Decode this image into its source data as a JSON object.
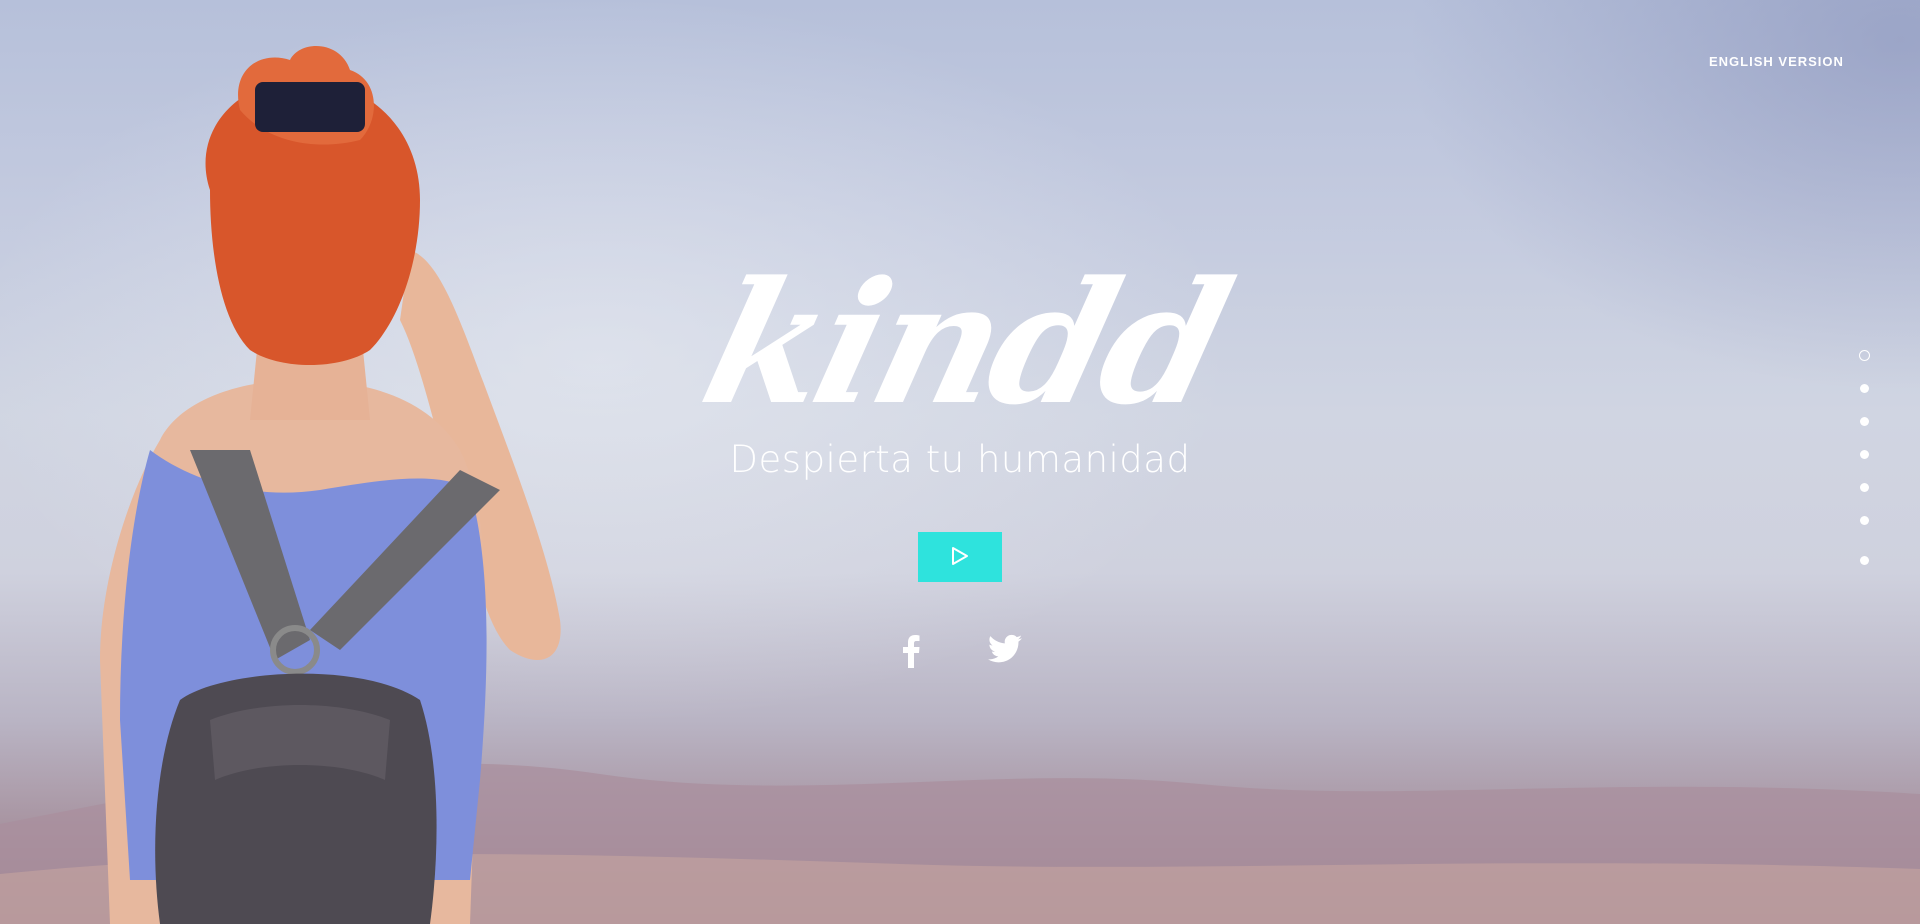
{
  "header": {
    "language_link": "ENGLISH VERSION"
  },
  "hero": {
    "logo_text": "kindd",
    "tagline": "Despierta tu humanidad",
    "play_button_icon": "play-icon"
  },
  "social": [
    {
      "name": "facebook-icon"
    },
    {
      "name": "twitter-icon"
    }
  ],
  "pagination": {
    "count": 7,
    "active_index": 0
  },
  "colors": {
    "accent": "#2ee3dd",
    "text": "#ffffff"
  }
}
